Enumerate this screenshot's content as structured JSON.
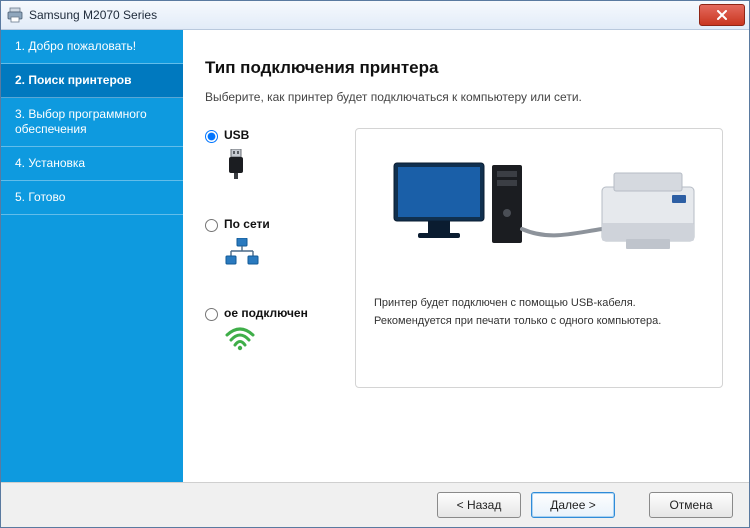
{
  "window": {
    "title": "Samsung M2070 Series"
  },
  "sidebar": {
    "items": [
      {
        "label": "1. Добро пожаловать!"
      },
      {
        "label": "2. Поиск принтеров"
      },
      {
        "label": "3. Выбор программного обеспечения"
      },
      {
        "label": "4. Установка"
      },
      {
        "label": "5. Готово"
      }
    ],
    "active_index": 1
  },
  "main": {
    "heading": "Тип подключения принтера",
    "subheading": "Выберите, как принтер будет подключаться к компьютеру или сети.",
    "options": [
      {
        "id": "usb",
        "label": "USB",
        "icon": "usb-icon"
      },
      {
        "id": "net",
        "label": "По сети",
        "icon": "network-icon"
      },
      {
        "id": "wifi",
        "label": "ое подключен",
        "icon": "wifi-icon"
      }
    ],
    "selected_option": "usb",
    "illustration": {
      "line1": "Принтер будет подключен с помощью USB-кабеля.",
      "line2": "Рекомендуется при печати только с одного компьютера."
    }
  },
  "footer": {
    "back": "< Назад",
    "next": "Далее >",
    "cancel": "Отмена"
  }
}
